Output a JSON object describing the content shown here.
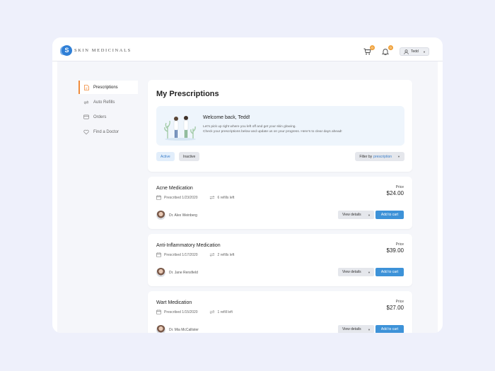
{
  "brand": {
    "mark": "S",
    "name": "SKIN MEDICINALS"
  },
  "header": {
    "cart_count": "0",
    "notif_count": "0",
    "user_name": "Tedd"
  },
  "sidebar": {
    "items": [
      {
        "label": "Prescriptions",
        "icon": "document-icon",
        "active": true
      },
      {
        "label": "Auto Refills",
        "icon": "refresh-icon",
        "active": false
      },
      {
        "label": "Orders",
        "icon": "card-icon",
        "active": false
      },
      {
        "label": "Find a Doctor",
        "icon": "heart-icon",
        "active": false
      }
    ]
  },
  "main": {
    "title": "My Prescriptions",
    "welcome": {
      "title": "Welcome back, Tedd!",
      "line1": "Let's pick up right where you left off and get your skin glowing.",
      "line2": "Check your prescriptions below and update us on your progress. Here's to clear days ahead!"
    },
    "tabs": {
      "active": "Active",
      "inactive": "Inactive"
    },
    "filter": {
      "prefix": "Filter by",
      "value": "prescription"
    }
  },
  "prescriptions": [
    {
      "name": "Acne Medication",
      "prescribed": "Prescribed 1/23/2020",
      "refills": "6 refills left",
      "price_label": "Price",
      "price": "$24.00",
      "doctor": "Dr. Alex Weinberg",
      "details_label": "View details",
      "cart_label": "Add to cart"
    },
    {
      "name": "Anti-Inflammatory Medication",
      "prescribed": "Prescribed 1/17/2020",
      "refills": "2 refills left",
      "price_label": "Price",
      "price": "$39.00",
      "doctor": "Dr. Jane Rensfield",
      "details_label": "View details",
      "cart_label": "Add to cart"
    },
    {
      "name": "Wart Medication",
      "prescribed": "Prescribed 1/15/2020",
      "refills": "1 refill left",
      "price_label": "Price",
      "price": "$27.00",
      "doctor": "Dr. Mia McCallister",
      "details_label": "View details",
      "cart_label": "Add to cart"
    }
  ],
  "colors": {
    "accent": "#3d92d8",
    "active_marker": "#f08a3a",
    "badge": "#f0a13a",
    "page_bg": "#eef0fb"
  }
}
